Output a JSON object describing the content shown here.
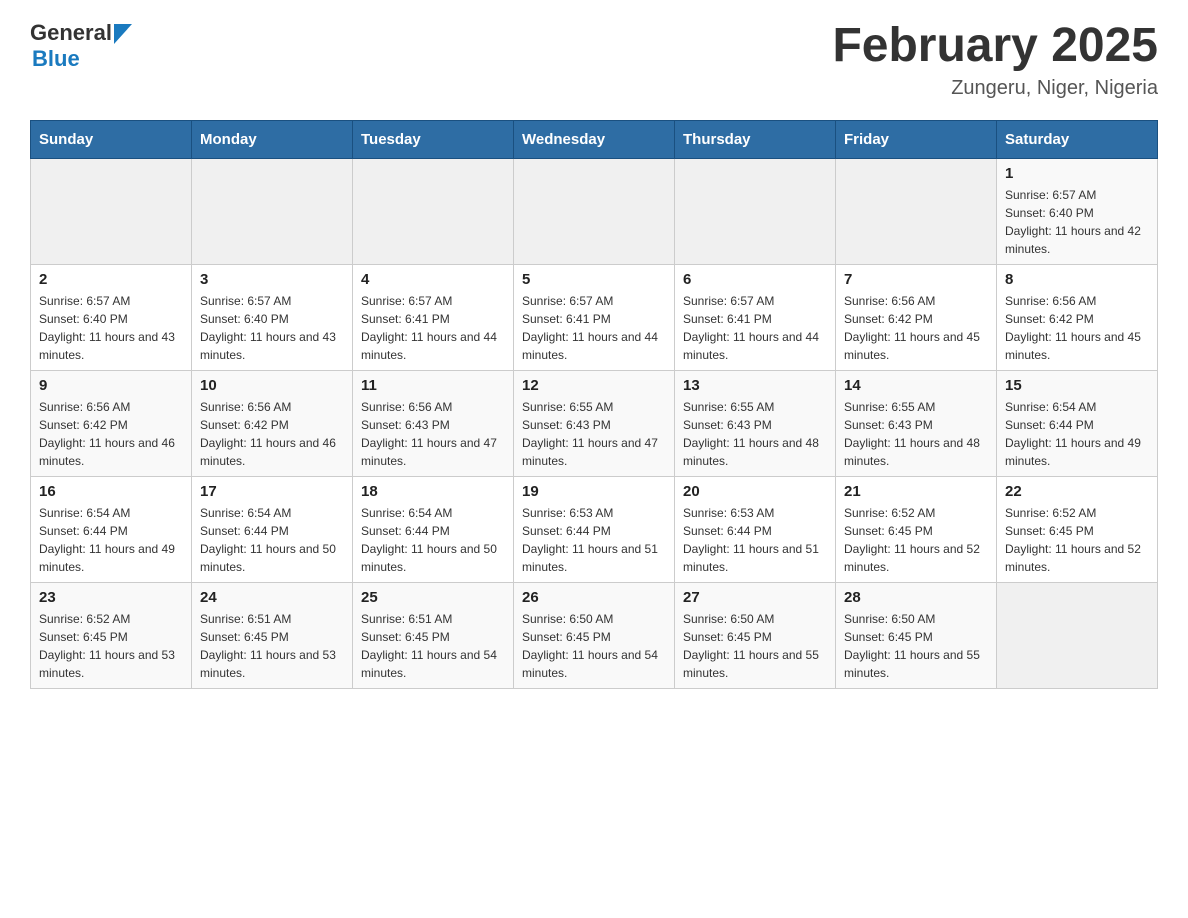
{
  "header": {
    "logo_general": "General",
    "logo_blue": "Blue",
    "month_title": "February 2025",
    "location": "Zungeru, Niger, Nigeria"
  },
  "days_of_week": [
    "Sunday",
    "Monday",
    "Tuesday",
    "Wednesday",
    "Thursday",
    "Friday",
    "Saturday"
  ],
  "weeks": [
    {
      "days": [
        {
          "date": "",
          "sunrise": "",
          "sunset": "",
          "daylight": "",
          "empty": true
        },
        {
          "date": "",
          "sunrise": "",
          "sunset": "",
          "daylight": "",
          "empty": true
        },
        {
          "date": "",
          "sunrise": "",
          "sunset": "",
          "daylight": "",
          "empty": true
        },
        {
          "date": "",
          "sunrise": "",
          "sunset": "",
          "daylight": "",
          "empty": true
        },
        {
          "date": "",
          "sunrise": "",
          "sunset": "",
          "daylight": "",
          "empty": true
        },
        {
          "date": "",
          "sunrise": "",
          "sunset": "",
          "daylight": "",
          "empty": true
        },
        {
          "date": "1",
          "sunrise": "Sunrise: 6:57 AM",
          "sunset": "Sunset: 6:40 PM",
          "daylight": "Daylight: 11 hours and 42 minutes.",
          "empty": false
        }
      ]
    },
    {
      "days": [
        {
          "date": "2",
          "sunrise": "Sunrise: 6:57 AM",
          "sunset": "Sunset: 6:40 PM",
          "daylight": "Daylight: 11 hours and 43 minutes.",
          "empty": false
        },
        {
          "date": "3",
          "sunrise": "Sunrise: 6:57 AM",
          "sunset": "Sunset: 6:40 PM",
          "daylight": "Daylight: 11 hours and 43 minutes.",
          "empty": false
        },
        {
          "date": "4",
          "sunrise": "Sunrise: 6:57 AM",
          "sunset": "Sunset: 6:41 PM",
          "daylight": "Daylight: 11 hours and 44 minutes.",
          "empty": false
        },
        {
          "date": "5",
          "sunrise": "Sunrise: 6:57 AM",
          "sunset": "Sunset: 6:41 PM",
          "daylight": "Daylight: 11 hours and 44 minutes.",
          "empty": false
        },
        {
          "date": "6",
          "sunrise": "Sunrise: 6:57 AM",
          "sunset": "Sunset: 6:41 PM",
          "daylight": "Daylight: 11 hours and 44 minutes.",
          "empty": false
        },
        {
          "date": "7",
          "sunrise": "Sunrise: 6:56 AM",
          "sunset": "Sunset: 6:42 PM",
          "daylight": "Daylight: 11 hours and 45 minutes.",
          "empty": false
        },
        {
          "date": "8",
          "sunrise": "Sunrise: 6:56 AM",
          "sunset": "Sunset: 6:42 PM",
          "daylight": "Daylight: 11 hours and 45 minutes.",
          "empty": false
        }
      ]
    },
    {
      "days": [
        {
          "date": "9",
          "sunrise": "Sunrise: 6:56 AM",
          "sunset": "Sunset: 6:42 PM",
          "daylight": "Daylight: 11 hours and 46 minutes.",
          "empty": false
        },
        {
          "date": "10",
          "sunrise": "Sunrise: 6:56 AM",
          "sunset": "Sunset: 6:42 PM",
          "daylight": "Daylight: 11 hours and 46 minutes.",
          "empty": false
        },
        {
          "date": "11",
          "sunrise": "Sunrise: 6:56 AM",
          "sunset": "Sunset: 6:43 PM",
          "daylight": "Daylight: 11 hours and 47 minutes.",
          "empty": false
        },
        {
          "date": "12",
          "sunrise": "Sunrise: 6:55 AM",
          "sunset": "Sunset: 6:43 PM",
          "daylight": "Daylight: 11 hours and 47 minutes.",
          "empty": false
        },
        {
          "date": "13",
          "sunrise": "Sunrise: 6:55 AM",
          "sunset": "Sunset: 6:43 PM",
          "daylight": "Daylight: 11 hours and 48 minutes.",
          "empty": false
        },
        {
          "date": "14",
          "sunrise": "Sunrise: 6:55 AM",
          "sunset": "Sunset: 6:43 PM",
          "daylight": "Daylight: 11 hours and 48 minutes.",
          "empty": false
        },
        {
          "date": "15",
          "sunrise": "Sunrise: 6:54 AM",
          "sunset": "Sunset: 6:44 PM",
          "daylight": "Daylight: 11 hours and 49 minutes.",
          "empty": false
        }
      ]
    },
    {
      "days": [
        {
          "date": "16",
          "sunrise": "Sunrise: 6:54 AM",
          "sunset": "Sunset: 6:44 PM",
          "daylight": "Daylight: 11 hours and 49 minutes.",
          "empty": false
        },
        {
          "date": "17",
          "sunrise": "Sunrise: 6:54 AM",
          "sunset": "Sunset: 6:44 PM",
          "daylight": "Daylight: 11 hours and 50 minutes.",
          "empty": false
        },
        {
          "date": "18",
          "sunrise": "Sunrise: 6:54 AM",
          "sunset": "Sunset: 6:44 PM",
          "daylight": "Daylight: 11 hours and 50 minutes.",
          "empty": false
        },
        {
          "date": "19",
          "sunrise": "Sunrise: 6:53 AM",
          "sunset": "Sunset: 6:44 PM",
          "daylight": "Daylight: 11 hours and 51 minutes.",
          "empty": false
        },
        {
          "date": "20",
          "sunrise": "Sunrise: 6:53 AM",
          "sunset": "Sunset: 6:44 PM",
          "daylight": "Daylight: 11 hours and 51 minutes.",
          "empty": false
        },
        {
          "date": "21",
          "sunrise": "Sunrise: 6:52 AM",
          "sunset": "Sunset: 6:45 PM",
          "daylight": "Daylight: 11 hours and 52 minutes.",
          "empty": false
        },
        {
          "date": "22",
          "sunrise": "Sunrise: 6:52 AM",
          "sunset": "Sunset: 6:45 PM",
          "daylight": "Daylight: 11 hours and 52 minutes.",
          "empty": false
        }
      ]
    },
    {
      "days": [
        {
          "date": "23",
          "sunrise": "Sunrise: 6:52 AM",
          "sunset": "Sunset: 6:45 PM",
          "daylight": "Daylight: 11 hours and 53 minutes.",
          "empty": false
        },
        {
          "date": "24",
          "sunrise": "Sunrise: 6:51 AM",
          "sunset": "Sunset: 6:45 PM",
          "daylight": "Daylight: 11 hours and 53 minutes.",
          "empty": false
        },
        {
          "date": "25",
          "sunrise": "Sunrise: 6:51 AM",
          "sunset": "Sunset: 6:45 PM",
          "daylight": "Daylight: 11 hours and 54 minutes.",
          "empty": false
        },
        {
          "date": "26",
          "sunrise": "Sunrise: 6:50 AM",
          "sunset": "Sunset: 6:45 PM",
          "daylight": "Daylight: 11 hours and 54 minutes.",
          "empty": false
        },
        {
          "date": "27",
          "sunrise": "Sunrise: 6:50 AM",
          "sunset": "Sunset: 6:45 PM",
          "daylight": "Daylight: 11 hours and 55 minutes.",
          "empty": false
        },
        {
          "date": "28",
          "sunrise": "Sunrise: 6:50 AM",
          "sunset": "Sunset: 6:45 PM",
          "daylight": "Daylight: 11 hours and 55 minutes.",
          "empty": false
        },
        {
          "date": "",
          "sunrise": "",
          "sunset": "",
          "daylight": "",
          "empty": true
        }
      ]
    }
  ]
}
